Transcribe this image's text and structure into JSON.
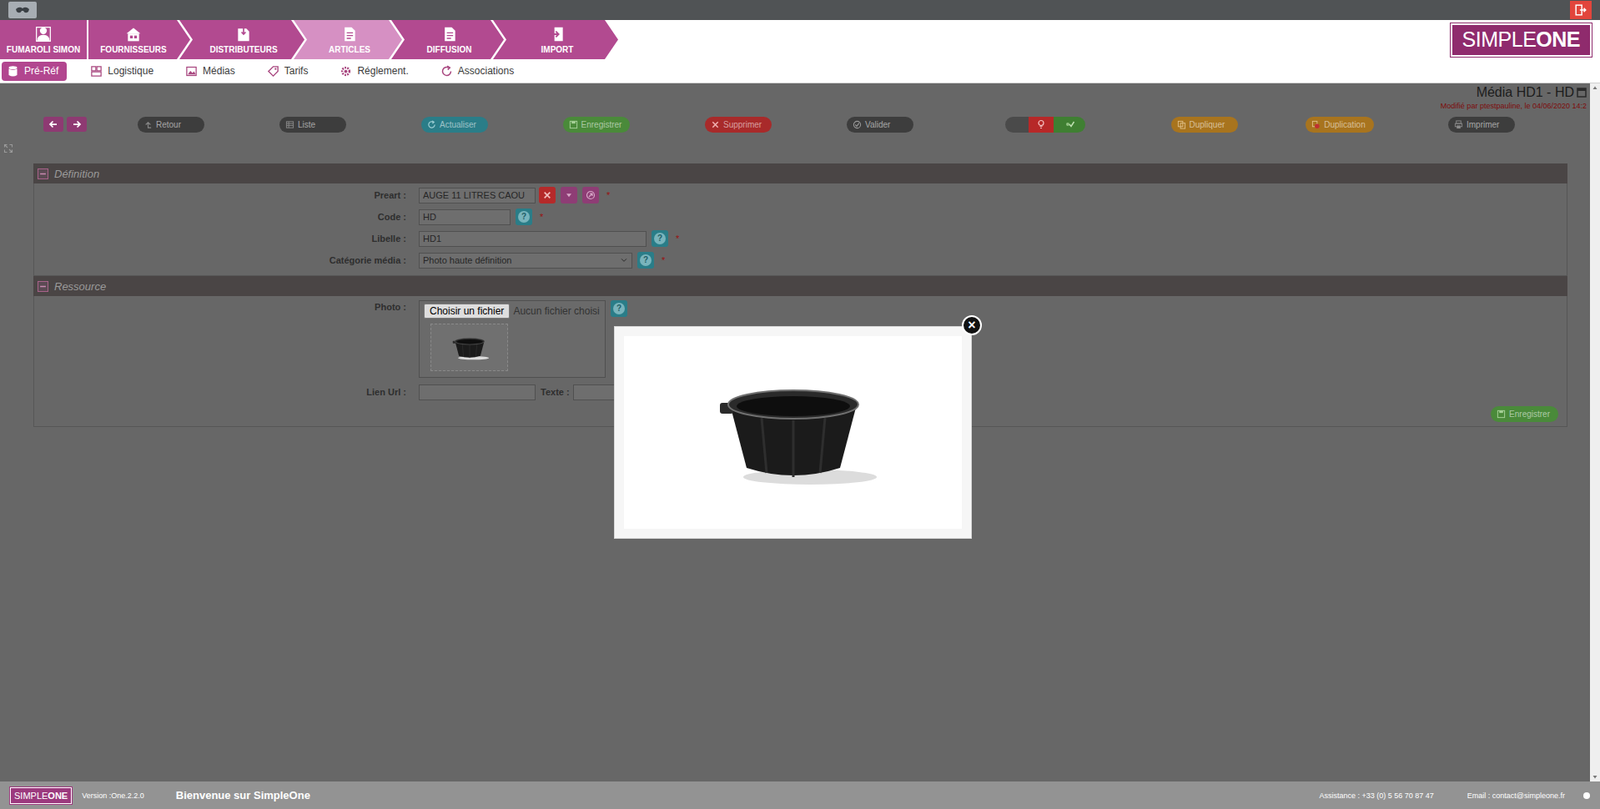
{
  "nav": {
    "tabs": [
      {
        "label": "FUMAROLI SIMON",
        "selected": false
      },
      {
        "label": "FOURNISSEURS",
        "selected": false
      },
      {
        "label": "DISTRIBUTEURS",
        "selected": false
      },
      {
        "label": "ARTICLES",
        "selected": true
      },
      {
        "label": "DIFFUSION",
        "selected": false
      },
      {
        "label": "IMPORT",
        "selected": false
      }
    ]
  },
  "logo": {
    "light": "SIMPLE",
    "bold": "ONE"
  },
  "subnav": [
    {
      "label": "Pré-Réf",
      "selected": true
    },
    {
      "label": "Logistique",
      "selected": false
    },
    {
      "label": "Médias",
      "selected": false
    },
    {
      "label": "Tarifs",
      "selected": false
    },
    {
      "label": "Réglement.",
      "selected": false
    },
    {
      "label": "Associations",
      "selected": false
    }
  ],
  "page": {
    "title": "Média HD1 - HD",
    "modified": "Modifié par ptestpauline, le 04/06/2020 14:2"
  },
  "toolbar": {
    "buttons": [
      {
        "label": "Retour",
        "color": "#3d3d3d"
      },
      {
        "label": "Liste",
        "color": "#3d3d3d"
      },
      {
        "label": "Actualiser",
        "color": "#2a7d88"
      },
      {
        "label": "Enregistrer",
        "color": "#4a8a3a"
      },
      {
        "label": "Supprimer",
        "color": "#a82a2a"
      },
      {
        "label": "Valider",
        "color": "#3d3d3d"
      },
      {
        "label": "Dupliquer",
        "color": "#a8741e"
      },
      {
        "label": "Duplication",
        "color": "#a8741e"
      },
      {
        "label": "Imprimer",
        "color": "#3d3d3d"
      }
    ]
  },
  "sections": [
    {
      "title": "Définition",
      "expanded": true,
      "fields": [
        {
          "label": "Preart :",
          "kind": "lookup",
          "value": "AUGE 11 LITRES CAOU",
          "required": "*"
        },
        {
          "label": "Code :",
          "kind": "text",
          "value": "HD",
          "help": "?",
          "required": "*"
        },
        {
          "label": "Libelle :",
          "kind": "text",
          "value": "HD1",
          "help": "?",
          "required": "*"
        },
        {
          "label": "Catégorie média :",
          "kind": "select",
          "value": "Photo haute définition",
          "help": "?",
          "required": "*"
        }
      ]
    },
    {
      "title": "Ressource",
      "expanded": true,
      "fields": [
        {
          "label": "Photo :",
          "kind": "file",
          "button": "Choisir un fichier",
          "status": "Aucun fichier choisi",
          "help": "?"
        },
        {
          "label": "Lien Url :",
          "kind": "link",
          "value": "",
          "second_label": "Texte :",
          "second_value": ""
        }
      ],
      "save": "Enregistrer"
    }
  ],
  "modal": {
    "open": true,
    "close": "×"
  },
  "footer": {
    "version": "Version :One.2.2.0",
    "welcome": "Bienvenue sur SimpleOne",
    "assistance": "Assistance : +33 (0) 5 56 70 87 47",
    "email": "Email : contact@simpleone.fr"
  }
}
